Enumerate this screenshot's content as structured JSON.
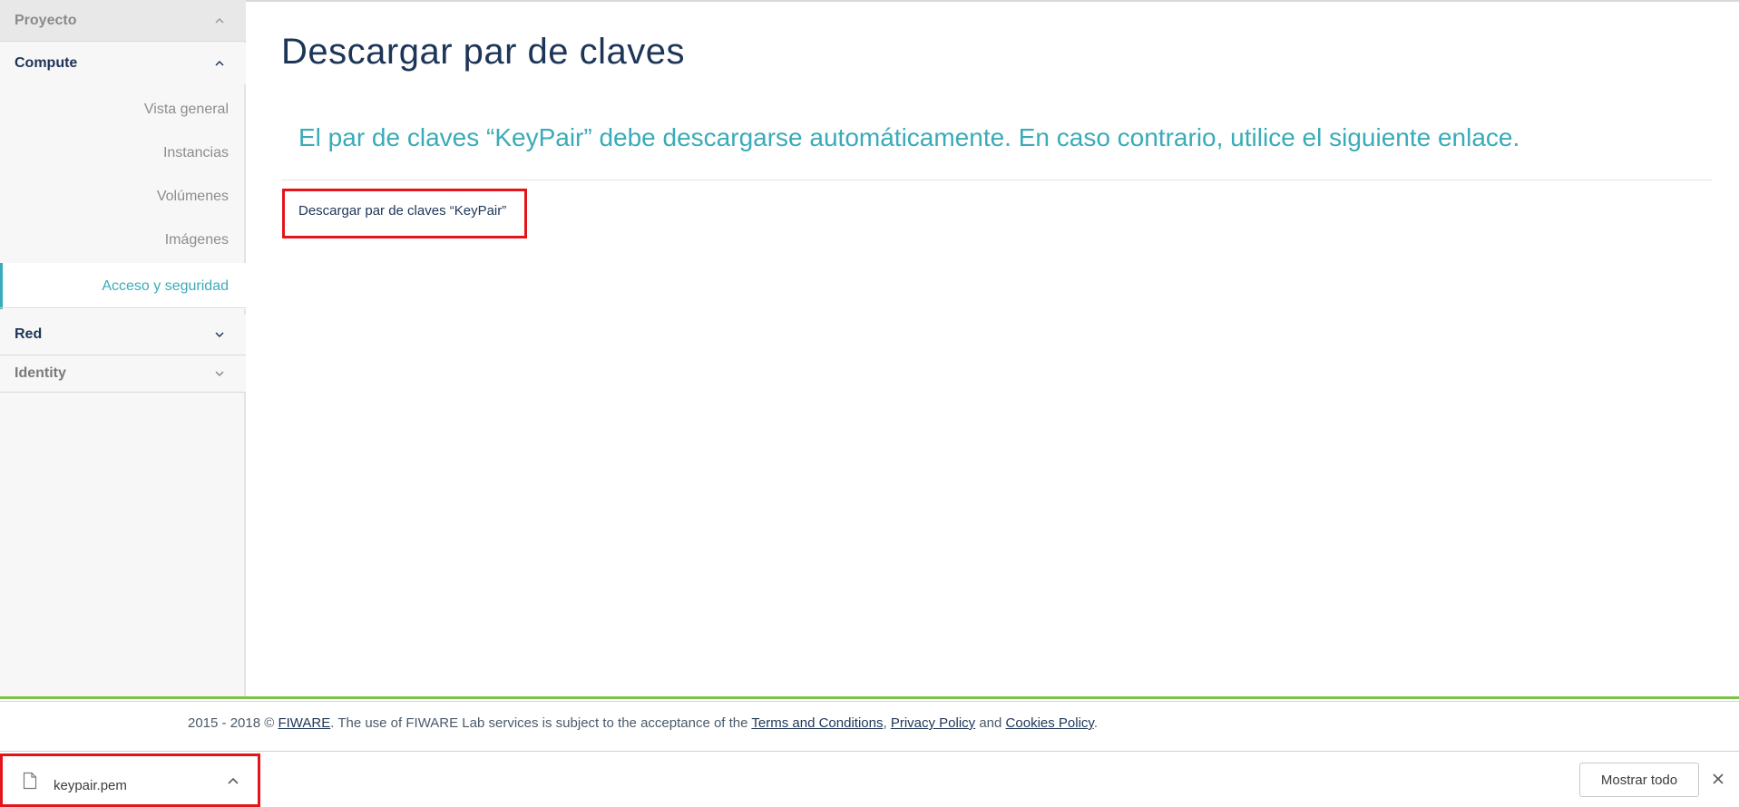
{
  "sidebar": {
    "proyecto": "Proyecto",
    "compute": "Compute",
    "items": [
      {
        "label": "Vista general"
      },
      {
        "label": "Instancias"
      },
      {
        "label": "Volúmenes"
      },
      {
        "label": "Imágenes"
      },
      {
        "label": "Acceso y seguridad",
        "active": true
      }
    ],
    "red": "Red",
    "identity": "Identity"
  },
  "main": {
    "title": "Descargar par de claves",
    "message": "El par de claves “KeyPair” debe descargarse automáticamente. En caso contrario, utilice el siguiente enlace.",
    "download_link": "Descargar par de claves “KeyPair”"
  },
  "footer": {
    "prefix": "2015 - 2018 © ",
    "fiware": "FIWARE",
    "middle": ". The use of FIWARE Lab services is subject to the acceptance of the ",
    "terms": "Terms and Conditions",
    "sep1": ", ",
    "privacy": "Privacy Policy",
    "and": " and ",
    "cookies": "Cookies Policy",
    "end": "."
  },
  "download_bar": {
    "file_name": "keypair.pem",
    "show_all": "Mostrar todo"
  },
  "colors": {
    "accent": "#3aabb8",
    "navy": "#1d3557",
    "highlight": "#e3151a",
    "footer_green": "#7cc24a"
  }
}
